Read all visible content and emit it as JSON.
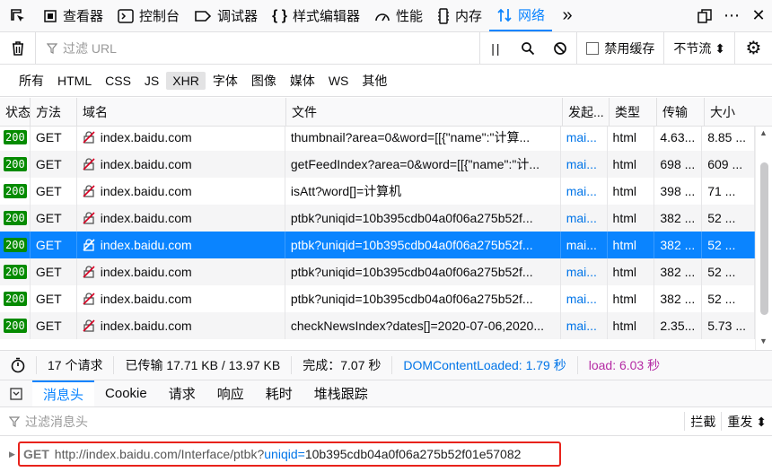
{
  "toolbar": {
    "tabs": [
      {
        "label": "查看器",
        "icon": "inspector-icon"
      },
      {
        "label": "控制台",
        "icon": "console-icon"
      },
      {
        "label": "调试器",
        "icon": "debugger-icon"
      },
      {
        "label": "样式编辑器",
        "icon": "style-editor-icon"
      },
      {
        "label": "性能",
        "icon": "performance-icon"
      },
      {
        "label": "内存",
        "icon": "memory-icon"
      },
      {
        "label": "网络",
        "icon": "network-icon",
        "active": true
      }
    ],
    "more": "»",
    "close": "✕"
  },
  "filterbar": {
    "url_placeholder": "过滤 URL",
    "pause": "||",
    "disable_cache_label": "禁用缓存",
    "throttle_label": "不节流 ⬍"
  },
  "typefilters": [
    "所有",
    "HTML",
    "CSS",
    "JS",
    "XHR",
    "字体",
    "图像",
    "媒体",
    "WS",
    "其他"
  ],
  "table": {
    "headers": [
      "状态",
      "方法",
      "域名",
      "文件",
      "发起...",
      "类型",
      "传输",
      "大小"
    ],
    "rows": [
      {
        "status": "200",
        "method": "GET",
        "domain": "index.baidu.com",
        "file": "thumbnail?area=0&word=[[{\"name\":\"计算...",
        "cause": "mai...",
        "type": "html",
        "transfer": "4.63...",
        "size": "8.85 ..."
      },
      {
        "status": "200",
        "method": "GET",
        "domain": "index.baidu.com",
        "file": "getFeedIndex?area=0&word=[[{\"name\":\"计...",
        "cause": "mai...",
        "type": "html",
        "transfer": "698 ...",
        "size": "609 ..."
      },
      {
        "status": "200",
        "method": "GET",
        "domain": "index.baidu.com",
        "file": "isAtt?word[]=计算机",
        "cause": "mai...",
        "type": "html",
        "transfer": "398 ...",
        "size": "71 ..."
      },
      {
        "status": "200",
        "method": "GET",
        "domain": "index.baidu.com",
        "file": "ptbk?uniqid=10b395cdb04a0f06a275b52f...",
        "cause": "mai...",
        "type": "html",
        "transfer": "382 ...",
        "size": "52 ..."
      },
      {
        "status": "200",
        "method": "GET",
        "domain": "index.baidu.com",
        "file": "ptbk?uniqid=10b395cdb04a0f06a275b52f...",
        "cause": "mai...",
        "type": "html",
        "transfer": "382 ...",
        "size": "52 ...",
        "selected": true
      },
      {
        "status": "200",
        "method": "GET",
        "domain": "index.baidu.com",
        "file": "ptbk?uniqid=10b395cdb04a0f06a275b52f...",
        "cause": "mai...",
        "type": "html",
        "transfer": "382 ...",
        "size": "52 ..."
      },
      {
        "status": "200",
        "method": "GET",
        "domain": "index.baidu.com",
        "file": "ptbk?uniqid=10b395cdb04a0f06a275b52f...",
        "cause": "mai...",
        "type": "html",
        "transfer": "382 ...",
        "size": "52 ..."
      },
      {
        "status": "200",
        "method": "GET",
        "domain": "index.baidu.com",
        "file": "checkNewsIndex?dates[]=2020-07-06,2020...",
        "cause": "mai...",
        "type": "html",
        "transfer": "2.35...",
        "size": "5.73 ..."
      }
    ]
  },
  "summary": {
    "requests": "17 个请求",
    "transferred": "已传输 17.71 KB / 13.97 KB",
    "finish": "完成：7.07 秒",
    "domcontent": "DOMContentLoaded: 1.79 秒",
    "load": "load: 6.03 秒"
  },
  "detail": {
    "tabs": [
      "消息头",
      "Cookie",
      "请求",
      "响应",
      "耗时",
      "堆栈跟踪"
    ],
    "filter_placeholder": "过滤消息头",
    "block_label": "拦截",
    "resend_label": "重发 ⬍"
  },
  "request_line": {
    "method": "GET",
    "url": "http://index.baidu.com/Interface/ptbk?",
    "param": "uniqid",
    "eq": "=",
    "value": "10b395cdb04a0f06a275b52f01e57082"
  },
  "colors": {
    "accent": "#0a84ff",
    "status_ok": "#058b00",
    "highlight_box": "#e8231c",
    "load": "#b52ba4"
  }
}
